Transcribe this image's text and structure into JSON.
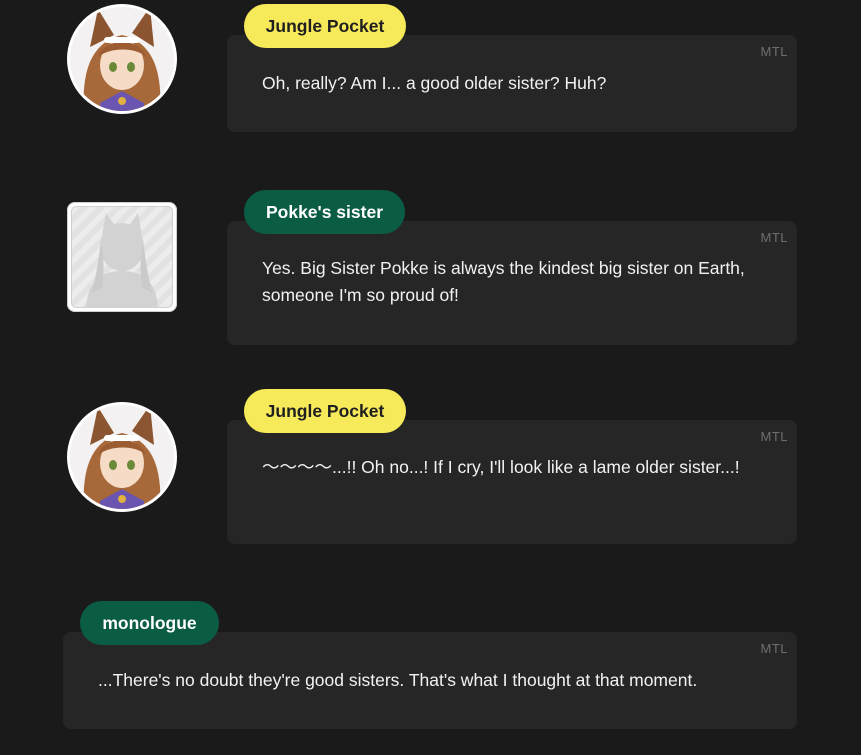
{
  "colors": {
    "background": "#1a1a1a",
    "bubble": "#262626",
    "tag_yellow": "#f7ea5a",
    "tag_green": "#0a5c45",
    "mtl_text": "#6e6e6e"
  },
  "messages": [
    {
      "speaker": "Jungle Pocket",
      "avatar": "jungle-pocket-avatar-icon",
      "tag_style": "yellow",
      "mtl": "MTL",
      "text": "Oh, really? Am I... a good older sister? Huh?"
    },
    {
      "speaker": "Pokke's sister",
      "avatar": "silhouette-avatar-icon",
      "tag_style": "green",
      "mtl": "MTL",
      "text": "Yes. Big Sister Pokke is always the kindest big sister on Earth, someone I'm so proud of!"
    },
    {
      "speaker": "Jungle Pocket",
      "avatar": "jungle-pocket-avatar-icon",
      "tag_style": "yellow",
      "mtl": "MTL",
      "text": "〜〜〜〜...!! Oh no...! If I cry, I'll look like a lame older sister...!"
    },
    {
      "speaker": "monologue",
      "avatar": "",
      "tag_style": "green",
      "mtl": "MTL",
      "text": "...There's no doubt they're good sisters. That's what I thought at that moment."
    }
  ]
}
